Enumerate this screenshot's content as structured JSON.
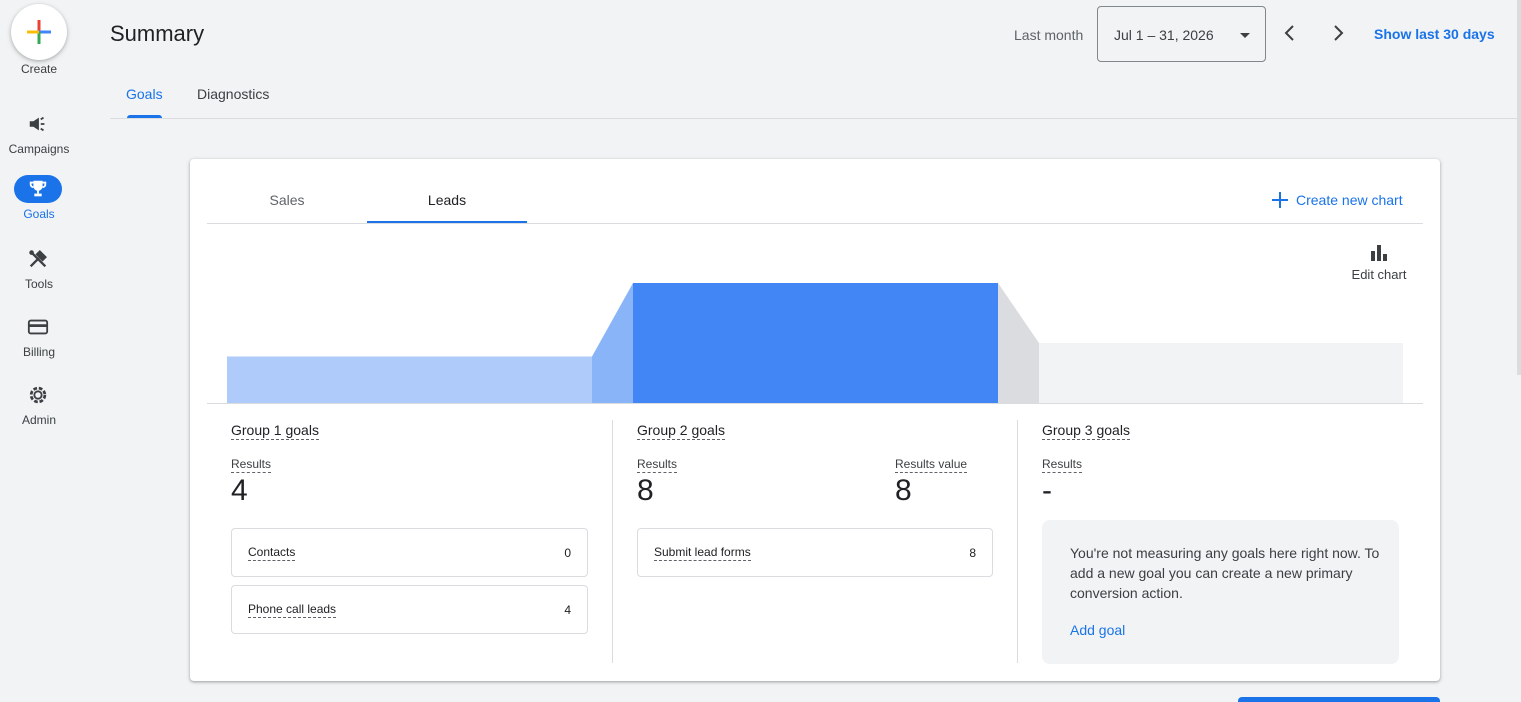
{
  "rail": {
    "create_label": "Create",
    "items": [
      {
        "label": "Campaigns",
        "icon": "megaphone-icon"
      },
      {
        "label": "Goals",
        "icon": "trophy-icon",
        "active": true
      },
      {
        "label": "Tools",
        "icon": "tools-icon"
      },
      {
        "label": "Billing",
        "icon": "credit-card-icon"
      },
      {
        "label": "Admin",
        "icon": "gear-icon"
      }
    ]
  },
  "header": {
    "title": "Summary",
    "period_label": "Last month",
    "date_range": "Jul 1 – 31, 2026",
    "show_last": "Show last 30 days"
  },
  "tabs": [
    {
      "label": "Goals",
      "active": true
    },
    {
      "label": "Diagnostics",
      "active": false
    }
  ],
  "card": {
    "tabs": [
      {
        "label": "Sales",
        "active": false
      },
      {
        "label": "Leads",
        "active": true
      }
    ],
    "create_chart": "Create new chart",
    "edit_chart": "Edit chart",
    "groups": [
      {
        "title": "Group 1 goals",
        "results_label": "Results",
        "results": "4",
        "rows": [
          {
            "name": "Contacts",
            "value": "0"
          },
          {
            "name": "Phone call leads",
            "value": "4"
          }
        ]
      },
      {
        "title": "Group 2 goals",
        "results_label": "Results",
        "results": "8",
        "value_label": "Results value",
        "value": "8",
        "rows": [
          {
            "name": "Submit lead forms",
            "value": "8"
          }
        ]
      },
      {
        "title": "Group 3 goals",
        "results_label": "Results",
        "results": "-",
        "empty_message": "You're not measuring any goals here right now. To add a new goal you can create a new primary conversion action.",
        "add_goal": "Add goal"
      }
    ]
  },
  "colors": {
    "accent": "#1a73e8",
    "funnel_g1": "#aecbfa",
    "funnel_g2": "#4285f4",
    "funnel_g3": "#f1f3f4",
    "background": "#f1f3f4"
  }
}
